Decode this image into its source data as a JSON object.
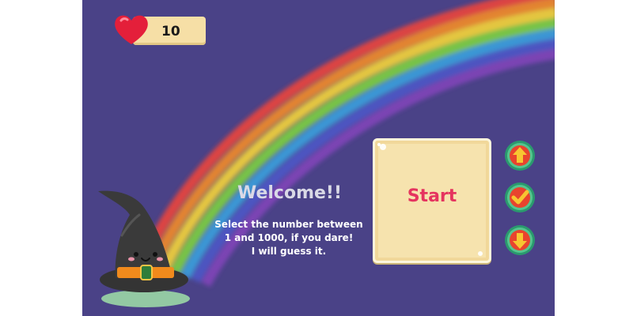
{
  "hud": {
    "lives": "10",
    "lives_icon": "heart-icon"
  },
  "intro": {
    "title": "Welcome!!",
    "lines": [
      "Select the number between",
      "1 and 1000, if you dare!",
      "I will guess it."
    ]
  },
  "start_button": {
    "label": "Start"
  },
  "controls": {
    "up_icon": "arrow-up-icon",
    "confirm_icon": "check-icon",
    "down_icon": "arrow-down-icon"
  },
  "colors": {
    "background": "#4a4287",
    "card": "#f6e3ae",
    "start_text": "#e5345f",
    "button_ring": "#2a9a6e",
    "button_fill": "#e8432e"
  }
}
